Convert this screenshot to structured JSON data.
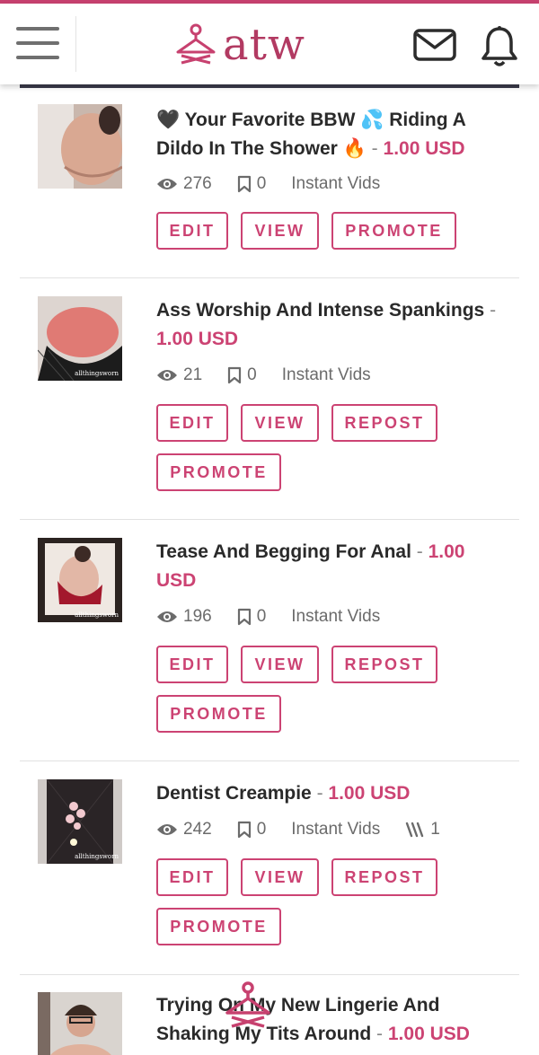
{
  "header": {
    "logo_text": "atw",
    "brand_color": "#c7416f",
    "menu_icon": "hamburger-menu-icon",
    "mail_icon": "envelope-icon",
    "bell_icon": "bell-icon"
  },
  "items": [
    {
      "title": "🖤 Your Favorite BBW 💦 Riding A Dildo In The Shower 🔥",
      "dash": "-",
      "price": "1.00 USD",
      "views": "276",
      "saves": "0",
      "category": "Instant Vids",
      "buttons": [
        "EDIT",
        "VIEW",
        "PROMOTE"
      ]
    },
    {
      "title": "Ass Worship And Intense Spankings",
      "dash": "-",
      "price": "1.00 USD",
      "views": "21",
      "saves": "0",
      "category": "Instant Vids",
      "buttons": [
        "EDIT",
        "VIEW",
        "REPOST",
        "PROMOTE"
      ]
    },
    {
      "title": "Tease And Begging For Anal",
      "dash": "-",
      "price": "1.00 USD",
      "views": "196",
      "saves": "0",
      "category": "Instant Vids",
      "buttons": [
        "EDIT",
        "VIEW",
        "REPOST",
        "PROMOTE"
      ]
    },
    {
      "title": "Dentist Creampie",
      "dash": "-",
      "price": "1.00 USD",
      "views": "242",
      "saves": "0",
      "category": "Instant Vids",
      "sales": "1",
      "buttons": [
        "EDIT",
        "VIEW",
        "REPOST",
        "PROMOTE"
      ]
    },
    {
      "title": "Trying On My New Lingerie And Shaking My Tits Around",
      "dash": "-",
      "price": "1.00 USD"
    }
  ]
}
